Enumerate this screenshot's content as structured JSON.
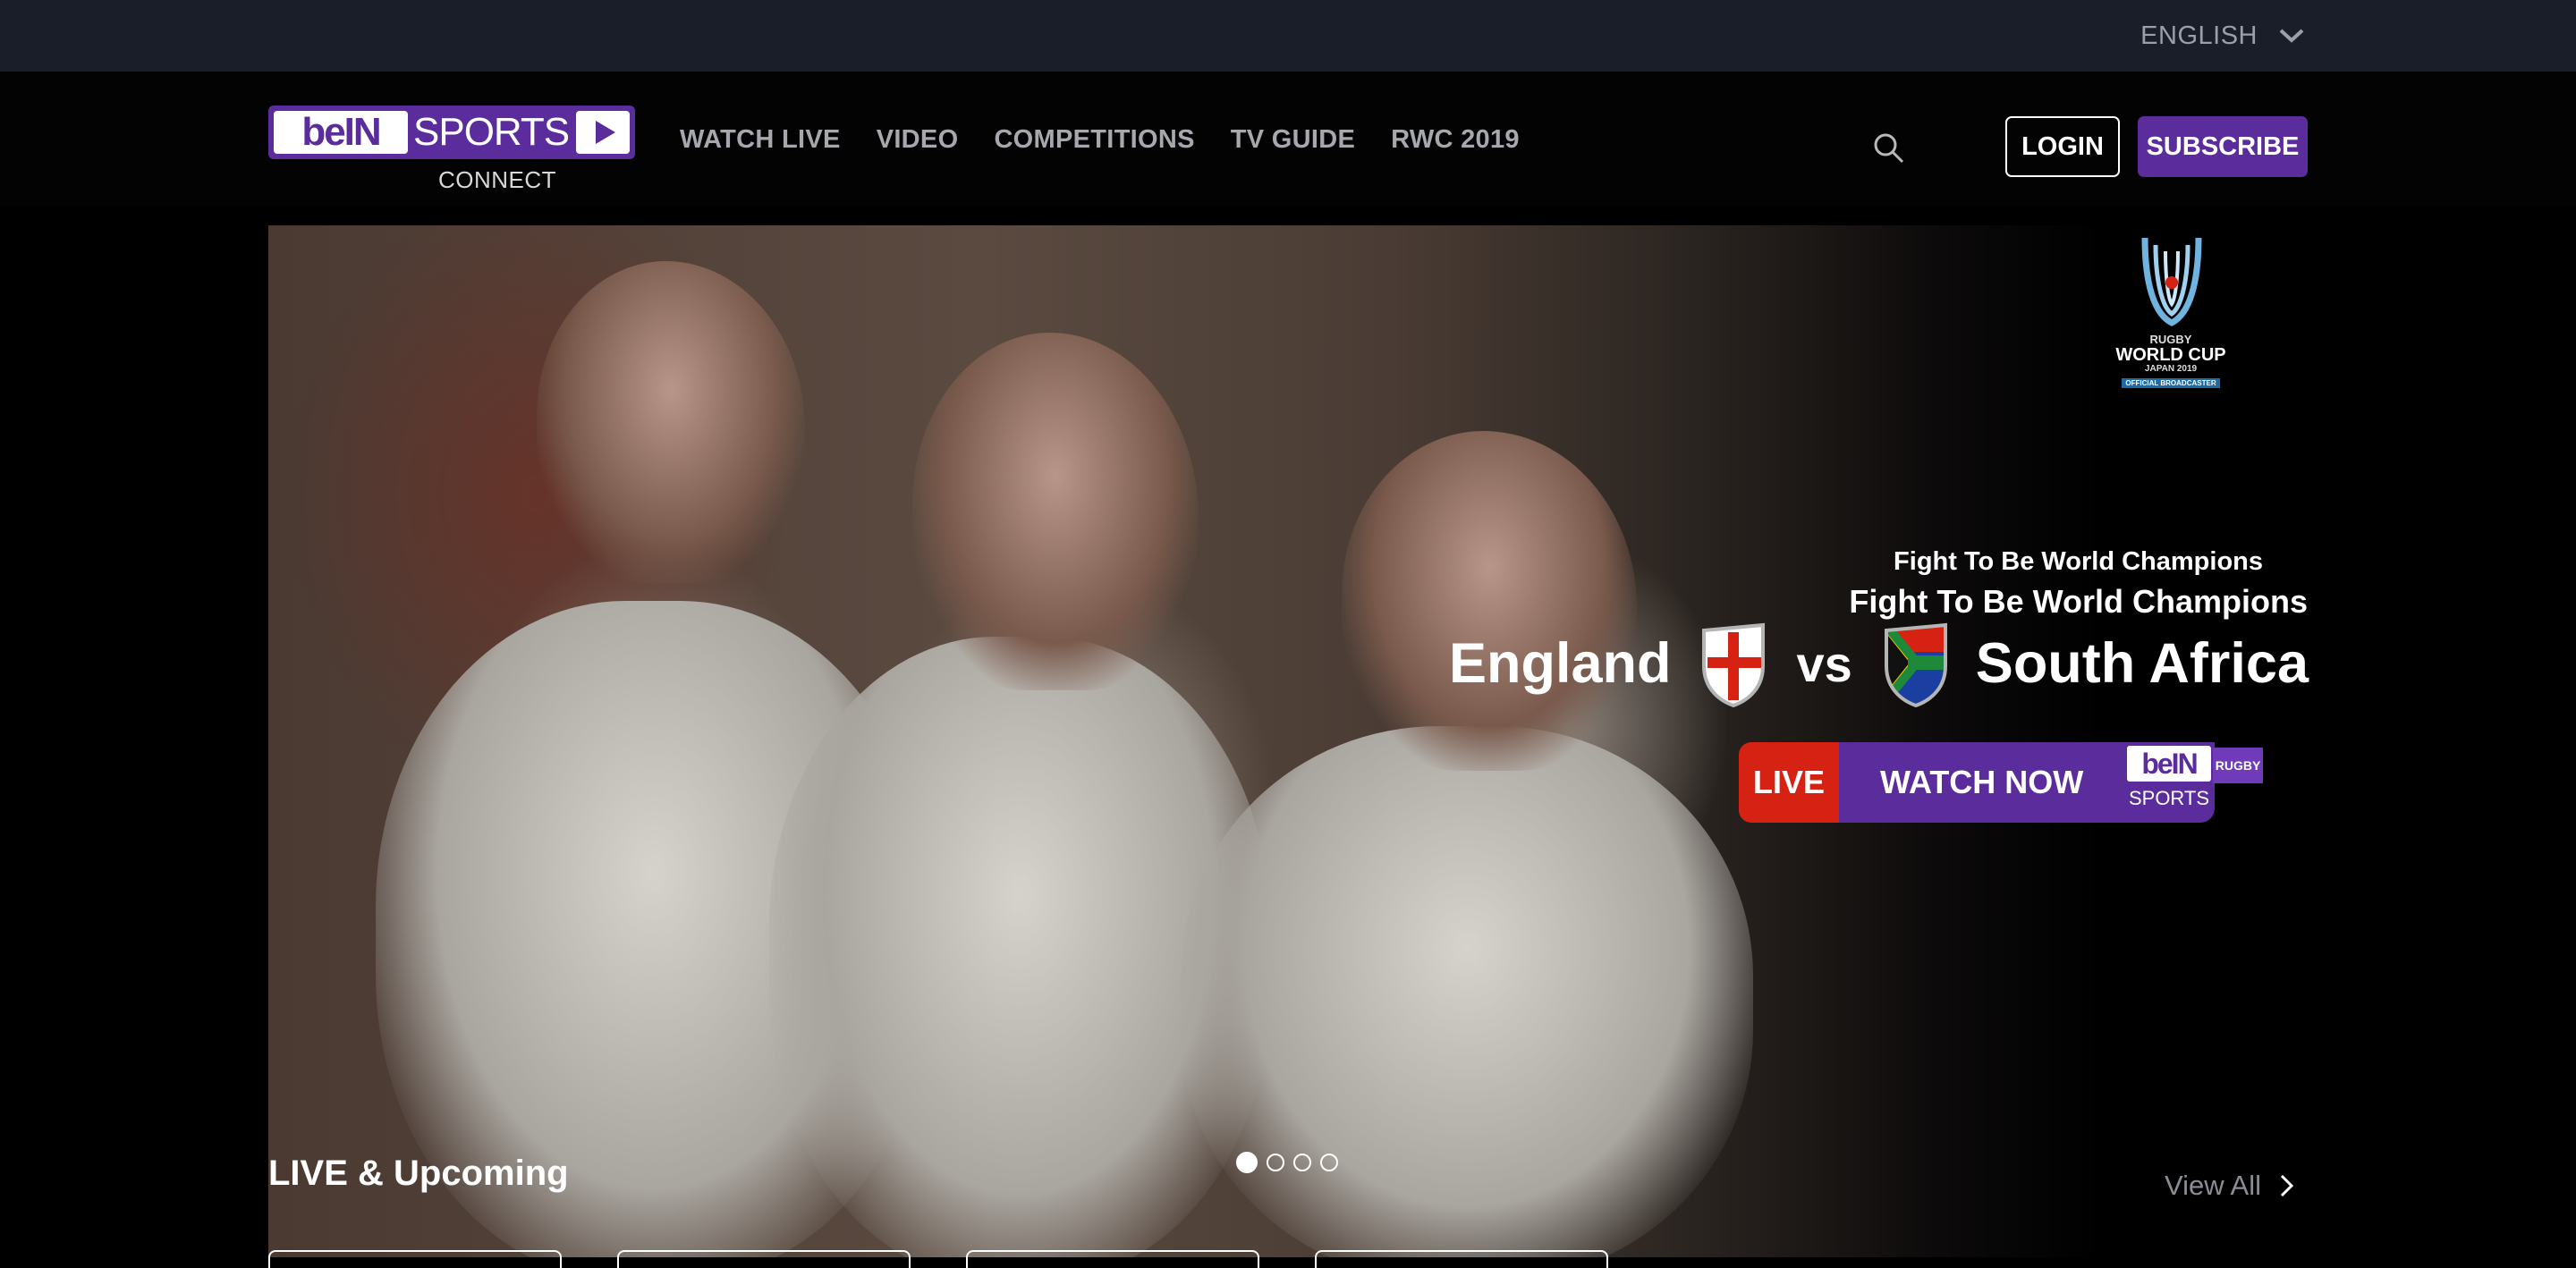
{
  "topbar": {
    "language": "ENGLISH"
  },
  "logo": {
    "bein": "beIN",
    "sports": "SPORTS",
    "connect": "CONNECT"
  },
  "nav": {
    "items": [
      "WATCH LIVE",
      "VIDEO",
      "COMPETITIONS",
      "TV GUIDE",
      "RWC 2019"
    ]
  },
  "actions": {
    "login": "LOGIN",
    "subscribe": "SUBSCRIBE"
  },
  "hero": {
    "rwc_logo": {
      "line1": "RUGBY",
      "line2": "WORLD CUP",
      "line3": "JAPAN 2019",
      "line4": "OFFICIAL BROADCASTER"
    },
    "tagline_small": "Fight To Be World Champions",
    "tagline_large": "Fight To Be World Champions",
    "team_home": "England",
    "vs": "vs",
    "team_away": "South Africa",
    "live_label": "LIVE",
    "watch_label": "WATCH NOW",
    "channel_bein": "beIN",
    "channel_sports": "SPORTS",
    "channel_tag": "RUGBY",
    "slides_total": 4,
    "slide_active": 1
  },
  "section": {
    "title": "LIVE & Upcoming",
    "view_all": "View All"
  },
  "colors": {
    "brand": "#5b2d9c",
    "live": "#d62212",
    "topbar": "#1a1e28"
  },
  "icons": {
    "language": "chevron-down-icon",
    "search": "search-icon",
    "view_all": "chevron-right-icon"
  }
}
